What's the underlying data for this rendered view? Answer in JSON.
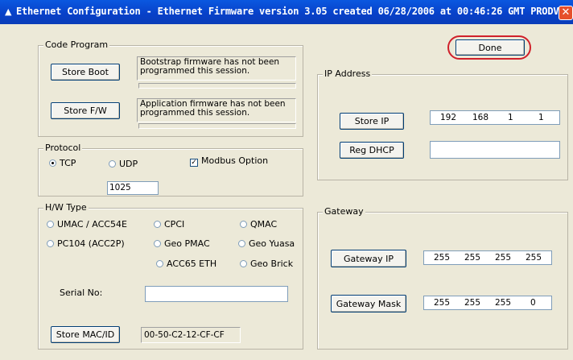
{
  "window": {
    "title": "Ethernet Configuration - Ethernet Firmware version 3.05 created 06/28/2006 at 00:46:26 GMT PRODVER",
    "icon": "app-icon",
    "close_glyph": "✕"
  },
  "done_button": "Done",
  "code_program": {
    "label": "Code Program",
    "store_boot": "Store Boot",
    "boot_message": "Bootstrap firmware has not been programmed this session.",
    "store_fw": "Store F/W",
    "fw_message": "Application firmware has not been programmed this session."
  },
  "protocol": {
    "label": "Protocol",
    "tcp": "TCP",
    "udp": "UDP",
    "selected": "TCP",
    "modbus_label": "Modbus Option",
    "modbus_checked": true,
    "port": "1025"
  },
  "hw_type": {
    "label": "H/W Type",
    "options": [
      "UMAC / ACC54E",
      "CPCI",
      "QMAC",
      "PC104 (ACC2P)",
      "Geo PMAC",
      "Geo Yuasa",
      "ACC65 ETH",
      "Geo Brick"
    ],
    "serial_label": "Serial No:",
    "serial_value": "",
    "store_mac": "Store MAC/ID",
    "mac_value": "00-50-C2-12-CF-CF"
  },
  "ip_address": {
    "label": "IP Address",
    "store_ip": "Store IP",
    "ip": [
      "192",
      "168",
      "1",
      "1"
    ],
    "reg_dhcp": "Reg DHCP",
    "dhcp_value": ""
  },
  "gateway": {
    "label": "Gateway",
    "gateway_ip_button": "Gateway IP",
    "gateway_ip": [
      "255",
      "255",
      "255",
      "255"
    ],
    "gateway_mask_button": "Gateway Mask",
    "gateway_mask": [
      "255",
      "255",
      "255",
      "0"
    ]
  }
}
